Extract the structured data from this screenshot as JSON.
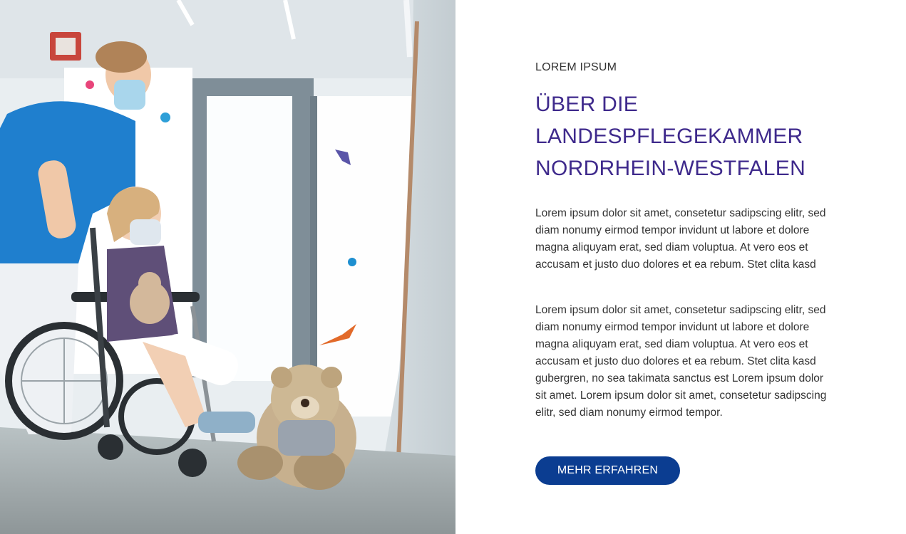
{
  "hero_image": {
    "icon": "hospital-photo-nurse-child-wheelchair"
  },
  "section": {
    "eyebrow": "LOREM IPSUM",
    "title_lines": [
      "ÜBER DIE",
      "LANDESPFLEGEKAMMER",
      "NORDRHEIN-WESTFALEN"
    ],
    "paragraphs": [
      "Lorem ipsum dolor sit amet, consetetur sadipscing elitr, sed diam nonumy eirmod tempor invidunt ut labore et dolore magna aliquyam erat, sed diam voluptua. At vero eos et accusam et justo duo dolores et ea rebum. Stet clita kasd",
      "Lorem ipsum dolor sit amet, consetetur sadipscing elitr, sed diam nonumy eirmod tempor invidunt ut labore et dolore magna aliquyam erat, sed diam voluptua. At vero eos et accusam et justo duo dolores et ea rebum. Stet clita kasd gubergren, no sea takimata sanctus est Lorem ipsum dolor sit amet. Lorem ipsum dolor sit amet, consetetur sadipscing elitr, sed diam nonumy eirmod tempor."
    ],
    "cta_label": "MEHR ERFAHREN"
  },
  "colors": {
    "title": "#3f2a8c",
    "button": "#0b3d91",
    "text": "#333333"
  }
}
